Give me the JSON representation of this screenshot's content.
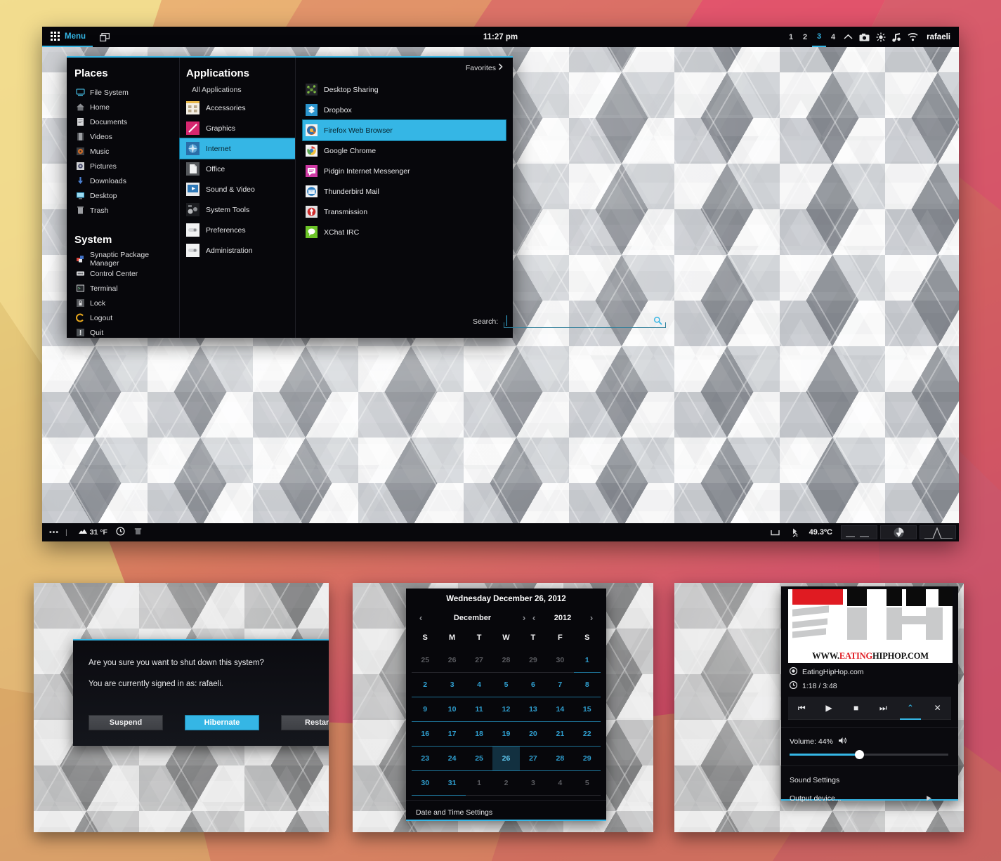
{
  "theme": {
    "accent": "#35b6e5",
    "panel_bg": "#07070b",
    "text": "#e7e8ea"
  },
  "top_panel": {
    "menu_label": "Menu",
    "menu_icon": "dot-grid-icon",
    "window_list_icon": "windows-icon",
    "clock": "11:27 pm",
    "workspaces": [
      "1",
      "2",
      "3",
      "4"
    ],
    "active_workspace": "3",
    "tray_icons": [
      "chevron-up-icon",
      "camera-icon",
      "brightness-icon",
      "music-note-icon",
      "wifi-icon"
    ],
    "user": "rafaeli"
  },
  "bottom_panel": {
    "dots": "•••",
    "separator": "|",
    "weather_icon": "cloud-icon",
    "weather": "31 °F",
    "clock_icon": "clock-icon",
    "trash_icon": "trash-icon",
    "show_desktop_icon": "show-desktop-icon",
    "bluetooth_icon": "bluetooth-disabled-icon",
    "temperature": "49.3ºC",
    "applets": [
      "network-monitor-applet",
      "disk-usage-applet",
      "cpu-graph-applet"
    ]
  },
  "menu": {
    "places_header": "Places",
    "places": [
      {
        "label": "File System",
        "icon": "computer-icon"
      },
      {
        "label": "Home",
        "icon": "home-icon"
      },
      {
        "label": "Documents",
        "icon": "documents-icon"
      },
      {
        "label": "Videos",
        "icon": "videos-icon"
      },
      {
        "label": "Music",
        "icon": "music-icon"
      },
      {
        "label": "Pictures",
        "icon": "pictures-icon"
      },
      {
        "label": "Downloads",
        "icon": "download-icon"
      },
      {
        "label": "Desktop",
        "icon": "desktop-icon"
      },
      {
        "label": "Trash",
        "icon": "trash-icon"
      }
    ],
    "system_header": "System",
    "system": [
      {
        "label": "Synaptic Package Manager",
        "icon": "synaptic-icon"
      },
      {
        "label": "Control Center",
        "icon": "control-center-icon"
      },
      {
        "label": "Terminal",
        "icon": "terminal-icon"
      },
      {
        "label": "Lock",
        "icon": "lock-icon"
      },
      {
        "label": "Logout",
        "icon": "logout-icon"
      },
      {
        "label": "Quit",
        "icon": "quit-icon"
      }
    ],
    "applications_header": "Applications",
    "all_applications": "All Applications",
    "categories": [
      {
        "label": "Accessories",
        "icon": "accessories-icon",
        "selected": false
      },
      {
        "label": "Graphics",
        "icon": "graphics-icon",
        "selected": false
      },
      {
        "label": "Internet",
        "icon": "internet-icon",
        "selected": true
      },
      {
        "label": "Office",
        "icon": "office-icon",
        "selected": false
      },
      {
        "label": "Sound & Video",
        "icon": "sound-video-icon",
        "selected": false
      },
      {
        "label": "System Tools",
        "icon": "system-tools-icon",
        "selected": false
      },
      {
        "label": "Preferences",
        "icon": "preferences-icon",
        "selected": false
      },
      {
        "label": "Administration",
        "icon": "administration-icon",
        "selected": false
      }
    ],
    "favorites_label": "Favorites",
    "favorites_icon": "chevron-right-icon",
    "apps": [
      {
        "label": "Desktop Sharing",
        "icon": "desktop-sharing-icon",
        "selected": false
      },
      {
        "label": "Dropbox",
        "icon": "dropbox-icon",
        "selected": false
      },
      {
        "label": "Firefox Web Browser",
        "icon": "firefox-icon",
        "selected": true
      },
      {
        "label": "Google Chrome",
        "icon": "chrome-icon",
        "selected": false
      },
      {
        "label": "Pidgin Internet Messenger",
        "icon": "pidgin-icon",
        "selected": false
      },
      {
        "label": "Thunderbird Mail",
        "icon": "thunderbird-icon",
        "selected": false
      },
      {
        "label": "Transmission",
        "icon": "transmission-icon",
        "selected": false
      },
      {
        "label": "XChat IRC",
        "icon": "xchat-icon",
        "selected": false
      }
    ],
    "search_label": "Search:",
    "search_value": "",
    "search_placeholder": "",
    "search_icon": "magnifier-icon"
  },
  "shutdown_dialog": {
    "question": "Are you sure you want to shut down this system?",
    "signed_in": "You are currently signed in as: rafaeli.",
    "buttons": [
      {
        "label": "Suspend",
        "primary": false
      },
      {
        "label": "Hibernate",
        "primary": true
      },
      {
        "label": "Restart",
        "primary": false
      }
    ]
  },
  "calendar": {
    "title": "Wednesday December 26, 2012",
    "month": "December",
    "year": "2012",
    "prev_month_icon": "chevron-left-icon",
    "next_month_icon": "chevron-right-icon",
    "prev_year_icon": "chevron-left-icon",
    "next_year_icon": "chevron-right-icon",
    "weekdays": [
      "S",
      "M",
      "T",
      "W",
      "T",
      "F",
      "S"
    ],
    "weeks": [
      [
        {
          "d": "25",
          "dim": true
        },
        {
          "d": "26",
          "dim": true
        },
        {
          "d": "27",
          "dim": true
        },
        {
          "d": "28",
          "dim": true
        },
        {
          "d": "29",
          "dim": true
        },
        {
          "d": "30",
          "dim": true
        },
        {
          "d": "1",
          "dim": false
        }
      ],
      [
        {
          "d": "2",
          "dim": false
        },
        {
          "d": "3",
          "dim": false
        },
        {
          "d": "4",
          "dim": false
        },
        {
          "d": "5",
          "dim": false
        },
        {
          "d": "6",
          "dim": false
        },
        {
          "d": "7",
          "dim": false
        },
        {
          "d": "8",
          "dim": false
        }
      ],
      [
        {
          "d": "9",
          "dim": false
        },
        {
          "d": "10",
          "dim": false
        },
        {
          "d": "11",
          "dim": false
        },
        {
          "d": "12",
          "dim": false
        },
        {
          "d": "13",
          "dim": false
        },
        {
          "d": "14",
          "dim": false
        },
        {
          "d": "15",
          "dim": false
        }
      ],
      [
        {
          "d": "16",
          "dim": false
        },
        {
          "d": "17",
          "dim": false
        },
        {
          "d": "18",
          "dim": false
        },
        {
          "d": "19",
          "dim": false
        },
        {
          "d": "20",
          "dim": false
        },
        {
          "d": "21",
          "dim": false
        },
        {
          "d": "22",
          "dim": false
        }
      ],
      [
        {
          "d": "23",
          "dim": false
        },
        {
          "d": "24",
          "dim": false
        },
        {
          "d": "25",
          "dim": false
        },
        {
          "d": "26",
          "dim": false,
          "today": true
        },
        {
          "d": "27",
          "dim": false
        },
        {
          "d": "28",
          "dim": false
        },
        {
          "d": "29",
          "dim": false
        }
      ],
      [
        {
          "d": "30",
          "dim": false
        },
        {
          "d": "31",
          "dim": false
        },
        {
          "d": "1",
          "dim": true
        },
        {
          "d": "2",
          "dim": true
        },
        {
          "d": "3",
          "dim": true
        },
        {
          "d": "4",
          "dim": true
        },
        {
          "d": "5",
          "dim": true
        }
      ]
    ],
    "footer": "Date and Time Settings"
  },
  "player": {
    "art_text_prefix": "WWW.",
    "art_text_red": "EATING",
    "art_text_rest": "HIPHOP.COM",
    "station_icon": "record-icon",
    "station": "EatingHipHop.com",
    "time_icon": "clock-icon",
    "time": "1:18 / 3:48",
    "controls": [
      {
        "icon": "previous-icon",
        "glyph": "⏮",
        "active": false
      },
      {
        "icon": "play-icon",
        "glyph": "▶",
        "active": false
      },
      {
        "icon": "stop-icon",
        "glyph": "■",
        "active": false
      },
      {
        "icon": "next-icon",
        "glyph": "⏭",
        "active": false
      },
      {
        "icon": "chevron-up-icon",
        "glyph": "⌃",
        "active": true
      },
      {
        "icon": "close-icon",
        "glyph": "✕",
        "active": false
      }
    ],
    "volume_label": "Volume: 44%",
    "volume_icon": "speaker-icon",
    "volume_percent": 44,
    "sound_settings": "Sound Settings",
    "output_device": "Output device...",
    "output_caret_icon": "caret-right-icon"
  }
}
